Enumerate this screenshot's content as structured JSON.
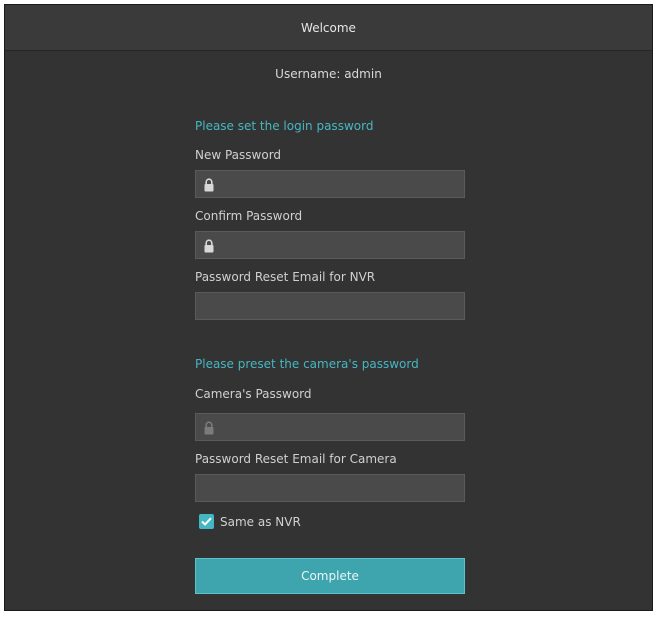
{
  "window": {
    "title": "Welcome"
  },
  "account": {
    "username_text": "Username: admin"
  },
  "login_section": {
    "title": "Please set the login password",
    "new_password_label": "New Password",
    "new_password_value": "",
    "confirm_password_label": "Confirm Password",
    "confirm_password_value": "",
    "reset_email_label": "Password Reset Email for NVR",
    "reset_email_value": ""
  },
  "camera_section": {
    "title": "Please preset the camera's password",
    "camera_password_label": "Camera's Password",
    "camera_password_value": "",
    "reset_email_label": "Password Reset Email for Camera",
    "reset_email_value": "",
    "same_as_nvr_label": "Same as NVR",
    "same_as_nvr_checked": true
  },
  "actions": {
    "complete_label": "Complete"
  },
  "colors": {
    "background": "#333333",
    "accent": "#45b7c2",
    "button": "#3ea4ae",
    "field": "#4a4a4a"
  },
  "icons": {
    "field_icon": "lock-icon",
    "checkbox_icon": "checkmark-icon"
  }
}
